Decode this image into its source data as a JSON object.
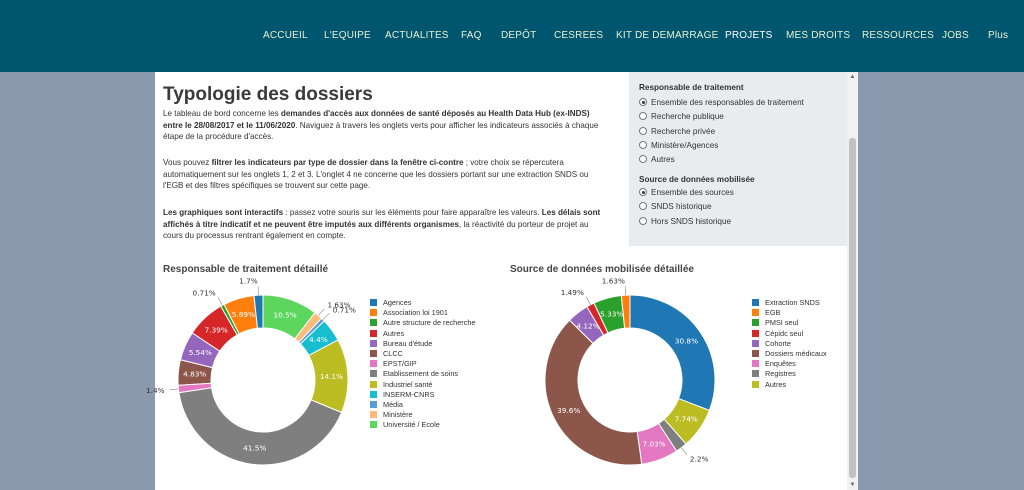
{
  "nav": {
    "items": [
      "ACCUEIL",
      "L'EQUIPE",
      "ACTUALITES",
      "FAQ",
      "DEPÔT",
      "CESREES",
      "KIT DE DEMARRAGE",
      "PROJETS",
      "MES DROITS",
      "RESSOURCES",
      "JOBS",
      "Plus"
    ],
    "active": "PROJETS"
  },
  "page": {
    "title": "Typologie des dossiers"
  },
  "intro": {
    "p1_a": "Le tableau de bord concerne les ",
    "p1_b": "demandes d'accès aux données de santé déposés au Health Data Hub (ex-INDS) entre le 28/08/2017 et le 11/06/2020",
    "p1_c": ". Naviguez à travers les onglets verts pour afficher les indicateurs associés à chaque étape de la procédure d'accès.",
    "p2_a": "Vous pouvez ",
    "p2_b": "filtrer les indicateurs par type de dossier dans la fenêtre ci-contre",
    "p2_c": " ; votre choix se répercutera automatiquement sur les onglets 1, 2 et 3. L'onglet 4 ne concerne que les dossiers portant sur une extraction SNDS ou l'EGB et des filtres spécifiques se trouvent sur cette page.",
    "p3_a": "Les graphiques sont interactifs",
    "p3_b": " : passez votre souris sur les éléments pour faire apparaître les valeurs. ",
    "p3_c": "Les délais sont affichés à titre indicatif et ne peuvent être imputés aux différents organismes",
    "p3_d": ", la réactivité du porteur de projet au cours du processus rentrant également en compte."
  },
  "filters": {
    "responsable": {
      "label": "Responsable de traitement",
      "options": [
        "Ensemble des responsables de traitement",
        "Recherche publique",
        "Recherche privée",
        "Ministère/Agences",
        "Autres"
      ],
      "selected": 0
    },
    "source": {
      "label": "Source de données mobilisée",
      "options": [
        "Ensemble des sources",
        "SNDS historique",
        "Hors SNDS historique"
      ],
      "selected": 0
    }
  },
  "chart_data": [
    {
      "type": "pie",
      "title": "Responsable de traitement détaillé",
      "categories": [
        "Agences",
        "Association loi 1901",
        "Autre structure de recherche",
        "Autres",
        "Bureau d'étude",
        "CLCC",
        "EPST/GIP",
        "Etablissement de soins",
        "Industriel santé",
        "INSERM-CNRS",
        "Média",
        "Ministère",
        "Université / Ecole"
      ],
      "colors": [
        "#1f77b4",
        "#ff7f0e",
        "#2ca02c",
        "#d62728",
        "#9467bd",
        "#8c564b",
        "#e377c2",
        "#7f7f7f",
        "#bcbd22",
        "#17becf",
        "#5b9bd5",
        "#ffbb78",
        "#5cd65c"
      ],
      "slices": [
        {
          "label": "10.5%",
          "value": 10.5,
          "category": 12
        },
        {
          "label": "1.63%",
          "value": 1.63,
          "category": 11
        },
        {
          "label": "0.71%",
          "value": 0.71,
          "category": 10
        },
        {
          "label": "4.4%",
          "value": 4.4,
          "category": 9
        },
        {
          "label": "14.1%",
          "value": 14.1,
          "category": 8
        },
        {
          "label": "41.5%",
          "value": 41.5,
          "category": 7
        },
        {
          "label": "1.4%",
          "value": 1.4,
          "category": 6
        },
        {
          "label": "4.83%",
          "value": 4.83,
          "category": 5
        },
        {
          "label": "5.54%",
          "value": 5.54,
          "category": 4
        },
        {
          "label": "7.39%",
          "value": 7.39,
          "category": 3
        },
        {
          "label": "0.71%",
          "value": 0.71,
          "category": 2
        },
        {
          "label": "5.89%",
          "value": 5.89,
          "category": 1
        },
        {
          "label": "1.7%",
          "value": 1.7,
          "category": 0
        }
      ],
      "legend": "right"
    },
    {
      "type": "pie",
      "title": "Source de données mobilisée détaillée",
      "categories": [
        "Extraction SNDS",
        "EGB",
        "PMSI seul",
        "Cépidc seul",
        "Cohorte",
        "Dossiers médicaux",
        "Enquêtes",
        "Registres",
        "Autres"
      ],
      "colors": [
        "#1f77b4",
        "#ff7f0e",
        "#2ca02c",
        "#d62728",
        "#9467bd",
        "#8c564b",
        "#e377c2",
        "#7f7f7f",
        "#bcbd22"
      ],
      "slices": [
        {
          "label": "30.8%",
          "value": 30.8,
          "category": 0
        },
        {
          "label": "7.74%",
          "value": 7.74,
          "category": 8
        },
        {
          "label": "2.2%",
          "value": 2.2,
          "category": 7
        },
        {
          "label": "7.03%",
          "value": 7.03,
          "category": 6
        },
        {
          "label": "39.6%",
          "value": 39.6,
          "category": 5
        },
        {
          "label": "4.12%",
          "value": 4.12,
          "category": 4
        },
        {
          "label": "1.49%",
          "value": 1.49,
          "category": 3
        },
        {
          "label": "5.33%",
          "value": 5.33,
          "category": 2
        },
        {
          "label": "1.63%",
          "value": 1.63,
          "category": 1
        }
      ],
      "legend": "right"
    }
  ]
}
